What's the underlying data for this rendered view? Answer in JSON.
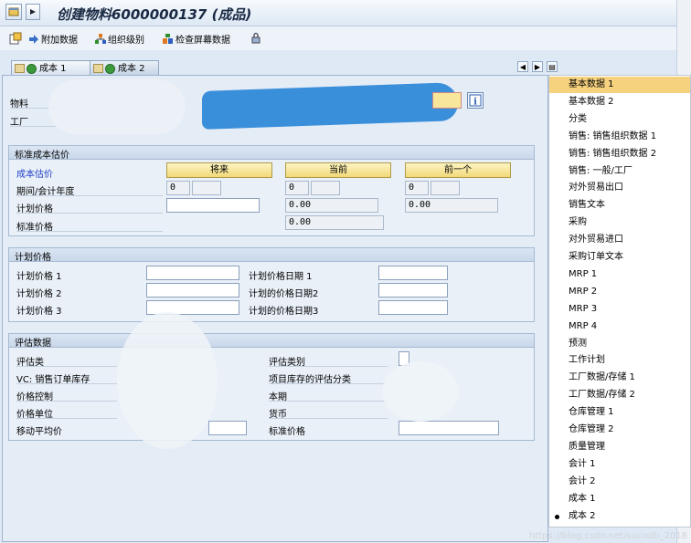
{
  "window": {
    "title": "创建物料6000000137 (成品)"
  },
  "toolbar": {
    "items": [
      {
        "label": "附加数据",
        "icon": "additional-data-icon"
      },
      {
        "label": "组织级别",
        "icon": "org-levels-icon"
      },
      {
        "label": "检查屏幕数据",
        "icon": "check-screen-data-icon"
      }
    ],
    "lock_icon": "lock-icon"
  },
  "tabs": [
    {
      "label": "成本 1",
      "active": false
    },
    {
      "label": "成本 2",
      "active": true
    }
  ],
  "header": {
    "material_label": "物料",
    "plant_label": "工厂"
  },
  "std_cost": {
    "title": "标准成本估价",
    "cost_estimate_label": "成本估价",
    "buttons": {
      "future": "将来",
      "current": "当前",
      "previous": "前一个"
    },
    "period_label": "期间/会计年度",
    "period_values": {
      "future": "0",
      "current": "0",
      "previous": "0"
    },
    "planned_price_label": "计划价格",
    "planned_price_values": {
      "current": "0.00",
      "previous": "0.00"
    },
    "std_price_label": "标准价格",
    "std_price_value": "0.00"
  },
  "planned_prices": {
    "title": "计划价格",
    "rows": [
      {
        "price_label": "计划价格 1",
        "date_label": "计划价格日期 1"
      },
      {
        "price_label": "计划价格 2",
        "date_label": "计划的价格日期2"
      },
      {
        "price_label": "计划价格 3",
        "date_label": "计划的价格日期3"
      }
    ]
  },
  "valuation": {
    "title": "评估数据",
    "left": [
      "评估类",
      "VC: 销售订单库存",
      "价格控制",
      "价格单位",
      "移动平均价"
    ],
    "right": [
      "评估类别",
      "项目库存的评估分类",
      "本期",
      "货币",
      "标准价格"
    ]
  },
  "menu": {
    "items": [
      {
        "label": "基本数据 1",
        "highlighted": true
      },
      {
        "label": "基本数据 2"
      },
      {
        "label": "分类"
      },
      {
        "label": "销售: 销售组织数据 1"
      },
      {
        "label": "销售: 销售组织数据 2"
      },
      {
        "label": "销售: 一般/工厂"
      },
      {
        "label": "对外贸易出口"
      },
      {
        "label": "销售文本"
      },
      {
        "label": "采购"
      },
      {
        "label": "对外贸易进口"
      },
      {
        "label": "采购订单文本"
      },
      {
        "label": "MRP 1"
      },
      {
        "label": "MRP 2"
      },
      {
        "label": "MRP 3"
      },
      {
        "label": "MRP 4"
      },
      {
        "label": "预测"
      },
      {
        "label": "工作计划"
      },
      {
        "label": "工厂数据/存储 1"
      },
      {
        "label": "工厂数据/存储 2"
      },
      {
        "label": "仓库管理 1"
      },
      {
        "label": "仓库管理 2"
      },
      {
        "label": "质量管理"
      },
      {
        "label": "会计 1"
      },
      {
        "label": "会计 2"
      },
      {
        "label": "成本 1"
      },
      {
        "label": "成本 2",
        "selected": true
      }
    ]
  },
  "watermark": "https://blog.csdn.net/sucodb_2018"
}
